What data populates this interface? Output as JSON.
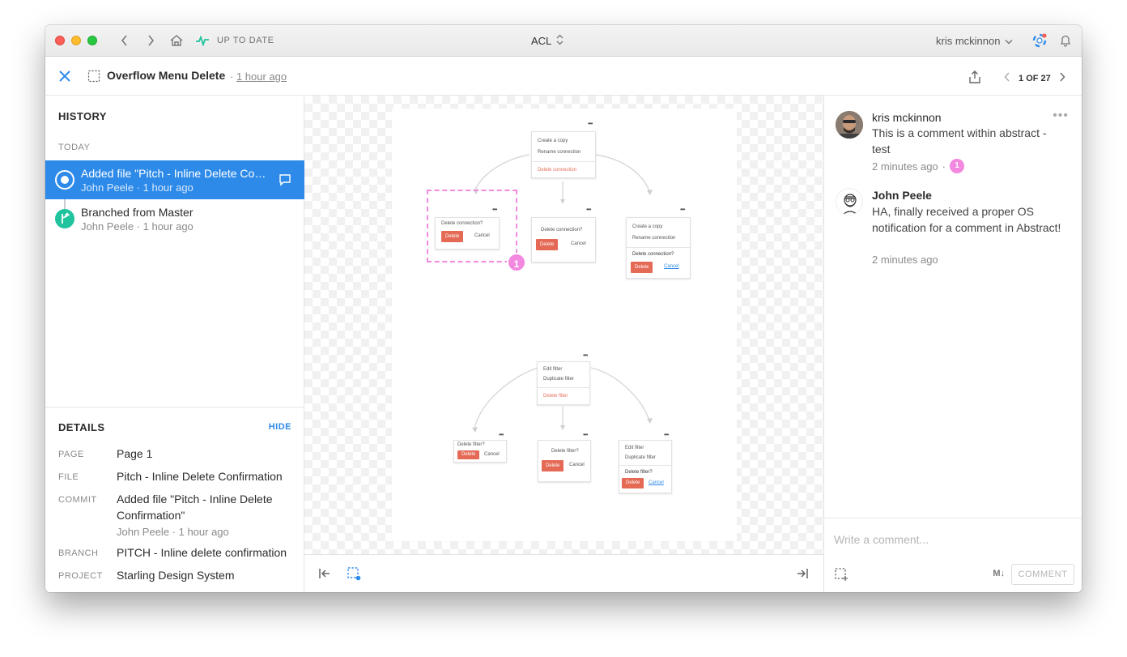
{
  "titlebar": {
    "status": "UP TO DATE",
    "project": "ACL",
    "user": "kris mckinnon"
  },
  "header": {
    "layer_title": "Overflow Menu Delete",
    "separator": "·",
    "time": "1 hour ago",
    "pager_current": "1",
    "pager_of": "OF",
    "pager_total": "27"
  },
  "history": {
    "heading": "HISTORY",
    "day": "TODAY",
    "items": [
      {
        "title": "Added file \"Pitch - Inline Delete Confirmation\"",
        "author": "John Peele",
        "time": "1 hour ago"
      },
      {
        "title": "Branched from Master",
        "author": "John Peele",
        "time": "1 hour ago"
      }
    ]
  },
  "details": {
    "heading": "DETAILS",
    "hide": "HIDE",
    "page_label": "PAGE",
    "page_value": "Page 1",
    "file_label": "FILE",
    "file_value": "Pitch - Inline Delete Confirmation",
    "commit_label": "COMMIT",
    "commit_value": "Added file \"Pitch - Inline Delete Confirmation\"",
    "commit_meta": "John Peele · 1 hour ago",
    "branch_label": "BRANCH",
    "branch_value": "PITCH - Inline delete confirmation",
    "project_label": "PROJECT",
    "project_value": "Starling Design System"
  },
  "artboard": {
    "pin_number": "1",
    "top_menu": [
      "Create a copy",
      "Rename connection",
      "Delete connection"
    ],
    "confirm_prompt": "Delete connection?",
    "delete_label": "Delete",
    "cancel_label": "Cancel",
    "bottom_menu": [
      "Edit filter",
      "Duplicate filter",
      "Delete filter"
    ],
    "filter_prompt": "Delete filter?"
  },
  "comments": [
    {
      "author": "kris mckinnon",
      "body": "This is a comment within abstract - test",
      "time": "2 minutes ago",
      "pin": "1"
    },
    {
      "author": "John Peele",
      "body": "HA, finally received a proper OS notification for a comment in Abstract!",
      "time": "2 minutes ago"
    }
  ],
  "composer": {
    "placeholder": "Write a comment...",
    "markdown": "M↓",
    "submit": "COMMENT"
  },
  "colors": {
    "accent": "#2d8ae9",
    "branch": "#1fc39d",
    "pin": "#f288e0",
    "danger": "#e46a55",
    "status": "#1fc39d"
  }
}
